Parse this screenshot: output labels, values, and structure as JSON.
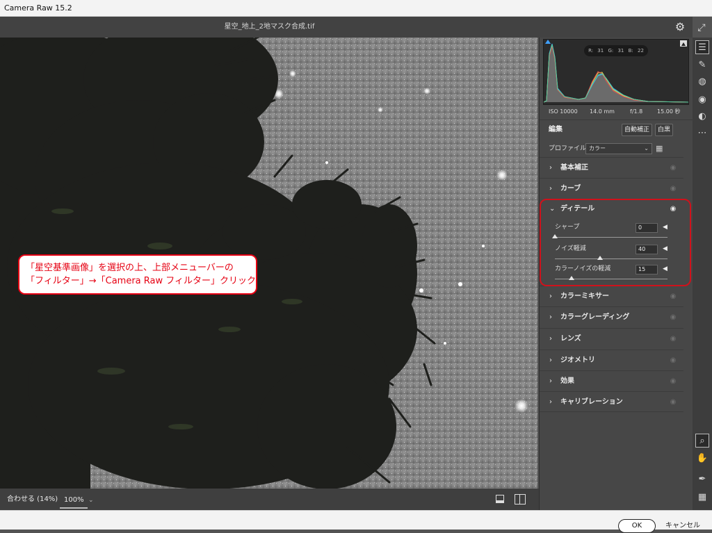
{
  "window": {
    "title": "Camera Raw 15.2"
  },
  "topbar": {
    "filename": "星空_地上_2地マスク合成.tif",
    "settings_icon": "gear-icon",
    "expand_icon": "expand-icon"
  },
  "callout": {
    "line1": "「星空基準画像」を選択の上、上部メニューバーの",
    "line2": "「フィルター」→「Camera Raw フィルター」クリック"
  },
  "bottombar": {
    "fit_label": "合わせる (14%)",
    "zoom_value": "100%"
  },
  "histogram": {
    "r": "R: 31",
    "g": "G: 31",
    "b": "B: 22"
  },
  "exif": {
    "iso": "ISO 10000",
    "focal": "14.0 mm",
    "aperture": "f/1.8",
    "shutter": "15.00 秒"
  },
  "edit": {
    "title": "編集",
    "auto_label": "自動補正",
    "bw_label": "白黒"
  },
  "profile": {
    "label": "プロファイル",
    "value": "カラー"
  },
  "sections": {
    "basic": "基本補正",
    "curve": "カーブ",
    "detail": "ディテール",
    "color_mixer": "カラーミキサー",
    "color_grading": "カラーグレーディング",
    "lens": "レンズ",
    "geometry": "ジオメトリ",
    "effects": "効果",
    "calibration": "キャリブレーション"
  },
  "detail_sliders": {
    "sharpen": {
      "label": "シャープ",
      "value": "0",
      "fraction": 0.0
    },
    "noise": {
      "label": "ノイズ軽減",
      "value": "40",
      "fraction": 0.4
    },
    "color_noise": {
      "label": "カラーノイズの軽減",
      "value": "15",
      "fraction": 0.15
    }
  },
  "footer": {
    "ok_label": "OK",
    "cancel_label": "キャンセル"
  },
  "colors": {
    "accent_red": "#e60012",
    "panel_bg": "#474747"
  }
}
